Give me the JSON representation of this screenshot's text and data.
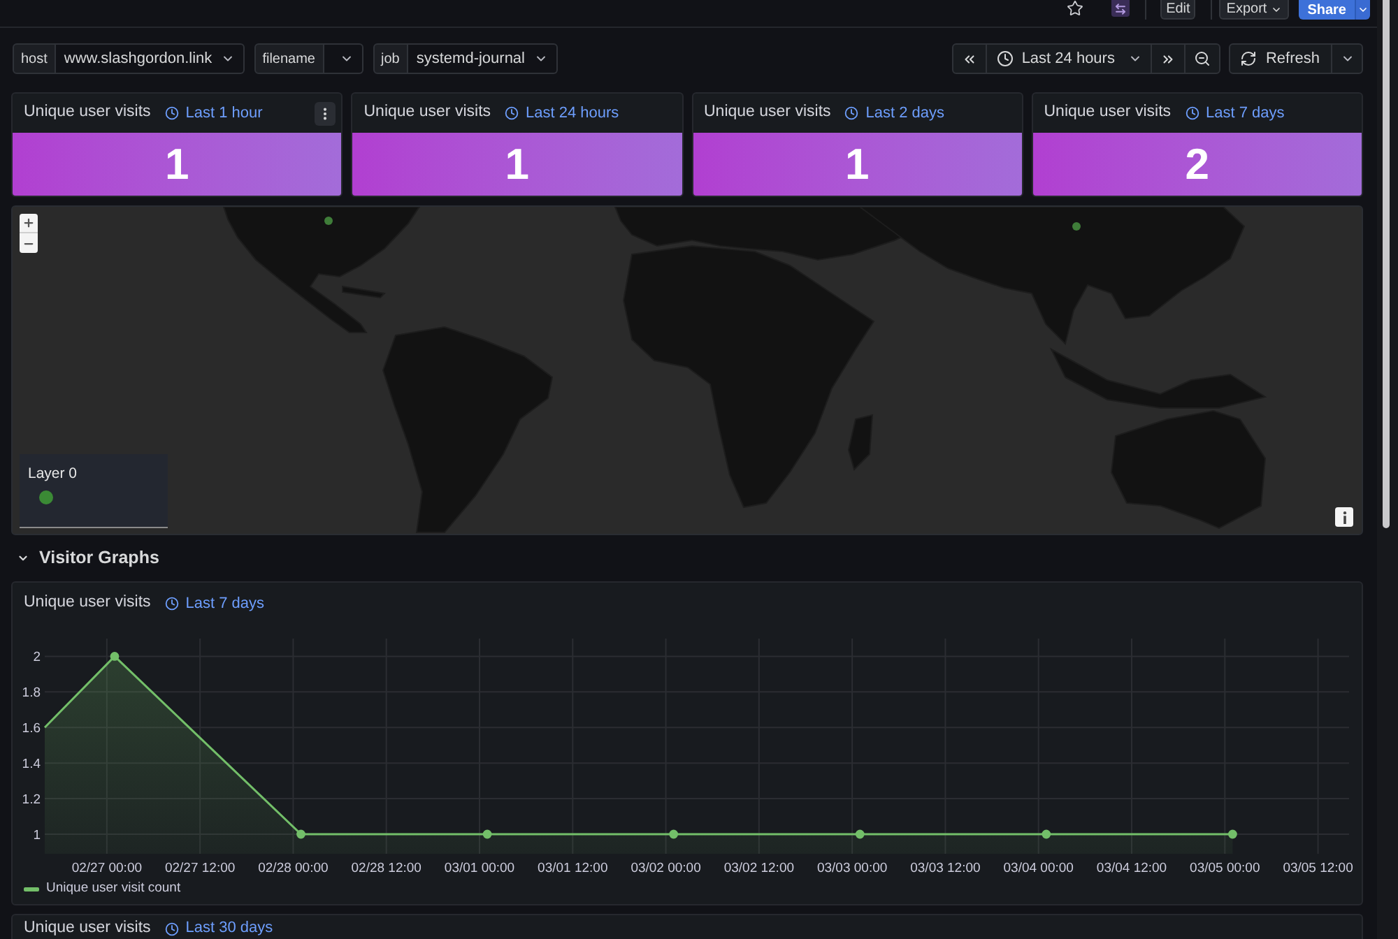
{
  "top_bar": {
    "starred": false,
    "buttons": [
      {
        "kind": "plain",
        "label": "Edit"
      },
      {
        "kind": "dropdown",
        "label": "Export"
      },
      {
        "kind": "primary_split",
        "label": "Share"
      }
    ]
  },
  "variables": [
    {
      "label": "host",
      "value": "www.slashgordon.link"
    },
    {
      "label": "filename"
    },
    {
      "label": "job",
      "value": "systemd-journal"
    }
  ],
  "time_picker": {
    "range": "Last 24 hours"
  },
  "refresh_button": {
    "label": "Refresh"
  },
  "stat_panels": [
    {
      "title": "Unique user visits",
      "time_range": "Last 1 hour",
      "value": "1",
      "menu_visible": true
    },
    {
      "title": "Unique user visits",
      "time_range": "Last 24 hours",
      "value": "1",
      "menu_visible": false
    },
    {
      "title": "Unique user visits",
      "time_range": "Last 2 days",
      "value": "1",
      "menu_visible": false
    },
    {
      "title": "Unique user visits",
      "time_range": "Last 7 days",
      "value": "2",
      "menu_visible": false
    }
  ],
  "map_panel": {
    "layers": [
      {
        "name": "Layer 0",
        "color": "#3b8a35"
      }
    ]
  },
  "sections": [
    {
      "title": "Visitor Graphs",
      "expanded": true
    }
  ],
  "graph_panel": {
    "title": "Unique user visits",
    "time_range": "Last 7 days",
    "chart_data": {
      "type": "area",
      "grid": true,
      "categories": [
        null,
        null,
        null,
        null,
        null,
        null,
        null,
        null,
        "02/27 00:00",
        null,
        null,
        null,
        null,
        null,
        null,
        null,
        null,
        null,
        null,
        null,
        "02/27 12:00",
        null,
        null,
        null,
        null,
        null,
        null,
        null,
        null,
        null,
        null,
        null,
        "02/28 00:00",
        null,
        null,
        null,
        null,
        null,
        null,
        null,
        null,
        null,
        null,
        null,
        "02/28 12:00",
        null,
        null,
        null,
        null,
        null,
        null,
        null,
        null,
        null,
        null,
        null,
        "03/01 00:00",
        null,
        null,
        null,
        null,
        null,
        null,
        null,
        null,
        null,
        null,
        null,
        "03/01 12:00",
        null,
        null,
        null,
        null,
        null,
        null,
        null,
        null,
        null,
        null,
        null,
        "03/02 00:00",
        null,
        null,
        null,
        null,
        null,
        null,
        null,
        null,
        null,
        null,
        null,
        "03/02 12:00",
        null,
        null,
        null,
        null,
        null,
        null,
        null,
        null,
        null,
        null,
        null,
        "03/03 00:00",
        null,
        null,
        null,
        null,
        null,
        null,
        null,
        null,
        null,
        null,
        null,
        "03/03 12:00",
        null,
        null,
        null,
        null,
        null,
        null,
        null,
        null,
        null,
        null,
        null,
        "03/04 00:00",
        null,
        null,
        null,
        null,
        null,
        null,
        null,
        null,
        null,
        null,
        null,
        "03/04 12:00",
        null,
        null,
        null,
        null,
        null,
        null,
        null,
        null,
        null,
        null,
        null,
        "03/05 00:00",
        null,
        null,
        null,
        null,
        null,
        null,
        null,
        null,
        null,
        null,
        null,
        "03/05 12:00",
        null,
        null,
        null,
        null
      ],
      "series": [
        {
          "name": "Unique user visit count",
          "color": "#73bf69",
          "marker": "o",
          "values": [
            1.6,
            null,
            null,
            null,
            null,
            null,
            null,
            null,
            null,
            2,
            null,
            null,
            null,
            null,
            null,
            null,
            null,
            null,
            null,
            null,
            null,
            null,
            null,
            null,
            null,
            null,
            null,
            null,
            null,
            null,
            null,
            null,
            null,
            1,
            null,
            null,
            null,
            null,
            null,
            null,
            null,
            null,
            null,
            null,
            null,
            null,
            null,
            null,
            null,
            null,
            null,
            null,
            null,
            null,
            null,
            null,
            null,
            1,
            null,
            null,
            null,
            null,
            null,
            null,
            null,
            null,
            null,
            null,
            null,
            null,
            null,
            null,
            null,
            null,
            null,
            null,
            null,
            null,
            null,
            null,
            null,
            1,
            null,
            null,
            null,
            null,
            null,
            null,
            null,
            null,
            null,
            null,
            null,
            null,
            null,
            null,
            null,
            null,
            null,
            null,
            null,
            null,
            null,
            null,
            null,
            1,
            null,
            null,
            null,
            null,
            null,
            null,
            null,
            null,
            null,
            null,
            null,
            null,
            null,
            null,
            null,
            null,
            null,
            null,
            null,
            null,
            null,
            null,
            null,
            1,
            null,
            null,
            null,
            null,
            null,
            null,
            null,
            null,
            null,
            null,
            null,
            null,
            null,
            null,
            null,
            null,
            null,
            null,
            null,
            null,
            null,
            null,
            null,
            1,
            null,
            null,
            null,
            null,
            null,
            null,
            null,
            null,
            null,
            null,
            null,
            null,
            null,
            null,
            null
          ]
        }
      ],
      "ylim": [
        0.89,
        2.1
      ],
      "yticks": [
        1,
        1.2,
        1.4,
        1.6,
        1.8,
        2
      ]
    }
  },
  "next_panel": {
    "title": "Unique user visits",
    "time_range": "Last 30 days"
  }
}
